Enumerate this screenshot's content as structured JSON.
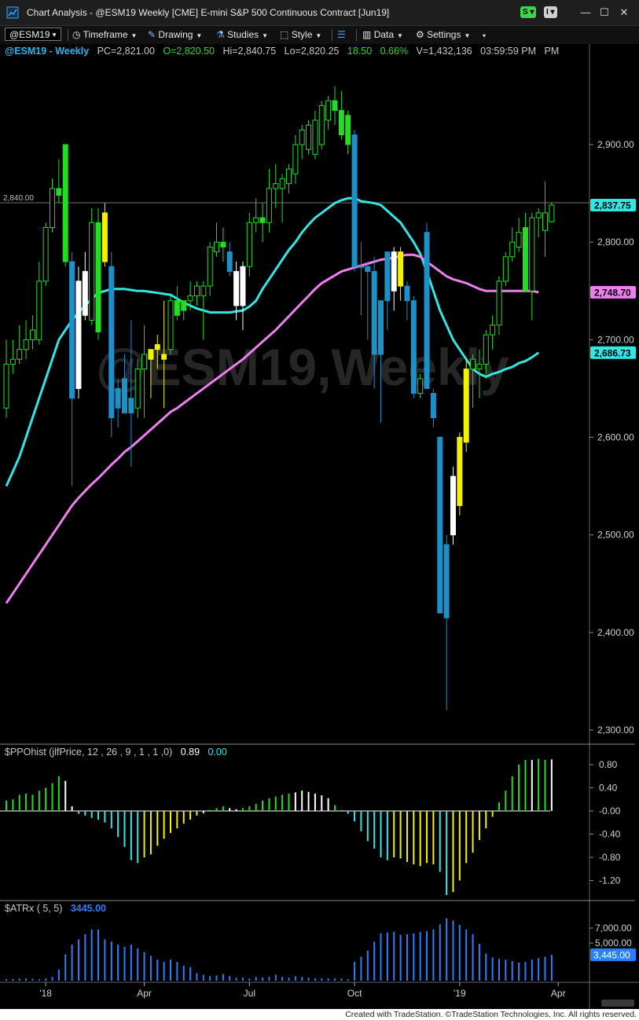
{
  "window": {
    "title": "Chart Analysis - @ESM19 Weekly [CME] E-mini S&P 500 Continuous Contract [Jun19]",
    "pill_s": "S",
    "pill_i": "I"
  },
  "toolbar": {
    "symbol": "@ESM19",
    "timeframe": "Timeframe",
    "drawing": "Drawing",
    "studies": "Studies",
    "style": "Style",
    "data": "Data",
    "settings": "Settings"
  },
  "header": {
    "symbol": "@ESM19 - Weekly",
    "pc": "PC=2,821.00",
    "open": "O=2,820.50",
    "high": "Hi=2,840.75",
    "low": "Lo=2,820.25",
    "change": "18.50",
    "pct": "0.66%",
    "volume": "V=1,432,136",
    "time": "03:59:59 PM",
    "watermark": "@ESM19,Weekly",
    "hline_label": "2,840.00"
  },
  "colors": {
    "bg": "#000000",
    "up": "#22dd22",
    "down": "#1e90c8",
    "yellow": "#f2f200",
    "white": "#ffffff",
    "cyan": "#33e6e6",
    "magenta": "#ee7fee",
    "atr": "#2a7fff"
  },
  "chart_data": [
    {
      "type": "candlestick",
      "title": "@ESM19 - Weekly",
      "ylim": [
        2290,
        2960
      ],
      "y_ticks": [
        "2,900.00",
        "2,800.00",
        "2,700.00",
        "2,600.00",
        "2,500.00",
        "2,400.00",
        "2,300.00"
      ],
      "x_ticks": [
        "'18",
        "Apr",
        "Jul",
        "Oct",
        "'19",
        "Apr"
      ],
      "last_price_labels": [
        "2,837.75",
        "2,748.70",
        "2,686.73"
      ],
      "reference_line": 2840,
      "candles": [
        {
          "o": 2630,
          "h": 2700,
          "l": 2620,
          "c": 2675,
          "col": "up"
        },
        {
          "o": 2675,
          "h": 2700,
          "l": 2665,
          "c": 2680,
          "col": "up"
        },
        {
          "o": 2680,
          "h": 2715,
          "l": 2675,
          "c": 2690,
          "col": "up"
        },
        {
          "o": 2690,
          "h": 2720,
          "l": 2680,
          "c": 2700,
          "col": "up"
        },
        {
          "o": 2700,
          "h": 2725,
          "l": 2690,
          "c": 2710,
          "col": "up"
        },
        {
          "o": 2700,
          "h": 2780,
          "l": 2695,
          "c": 2760,
          "col": "up"
        },
        {
          "o": 2760,
          "h": 2820,
          "l": 2755,
          "c": 2815,
          "col": "up"
        },
        {
          "o": 2815,
          "h": 2865,
          "l": 2810,
          "c": 2855,
          "col": "up"
        },
        {
          "o": 2855,
          "h": 2885,
          "l": 2840,
          "c": 2848,
          "col": "up"
        },
        {
          "o": 2900,
          "h": 2900,
          "l": 2775,
          "c": 2780,
          "col": "up"
        },
        {
          "o": 2780,
          "h": 2790,
          "l": 2550,
          "c": 2640,
          "col": "down"
        },
        {
          "o": 2650,
          "h": 2775,
          "l": 2640,
          "c": 2760,
          "col": "white"
        },
        {
          "o": 2725,
          "h": 2790,
          "l": 2720,
          "c": 2770,
          "col": "white"
        },
        {
          "o": 2720,
          "h": 2835,
          "l": 2715,
          "c": 2820,
          "col": "up"
        },
        {
          "o": 2820,
          "h": 2835,
          "l": 2700,
          "c": 2708,
          "col": "up"
        },
        {
          "o": 2780,
          "h": 2840,
          "l": 2775,
          "c": 2830,
          "col": "yellow"
        },
        {
          "o": 2775,
          "h": 2790,
          "l": 2600,
          "c": 2620,
          "col": "down"
        },
        {
          "o": 2630,
          "h": 2660,
          "l": 2610,
          "c": 2650,
          "col": "down"
        },
        {
          "o": 2660,
          "h": 2685,
          "l": 2625,
          "c": 2625,
          "col": "down"
        },
        {
          "o": 2640,
          "h": 2720,
          "l": 2570,
          "c": 2625,
          "col": "down"
        },
        {
          "o": 2630,
          "h": 2680,
          "l": 2620,
          "c": 2670,
          "col": "up"
        },
        {
          "o": 2670,
          "h": 2715,
          "l": 2620,
          "c": 2685,
          "col": "up"
        },
        {
          "o": 2680,
          "h": 2690,
          "l": 2640,
          "c": 2690,
          "col": "yellow"
        },
        {
          "o": 2690,
          "h": 2705,
          "l": 2670,
          "c": 2695,
          "col": "yellow"
        },
        {
          "o": 2680,
          "h": 2740,
          "l": 2630,
          "c": 2685,
          "col": "yellow"
        },
        {
          "o": 2690,
          "h": 2745,
          "l": 2685,
          "c": 2740,
          "col": "up"
        },
        {
          "o": 2740,
          "h": 2755,
          "l": 2720,
          "c": 2725,
          "col": "up"
        },
        {
          "o": 2740,
          "h": 2740,
          "l": 2720,
          "c": 2730,
          "col": "up"
        },
        {
          "o": 2740,
          "h": 2760,
          "l": 2730,
          "c": 2745,
          "col": "up"
        },
        {
          "o": 2745,
          "h": 2760,
          "l": 2735,
          "c": 2755,
          "col": "up"
        },
        {
          "o": 2745,
          "h": 2760,
          "l": 2700,
          "c": 2755,
          "col": "up"
        },
        {
          "o": 2755,
          "h": 2800,
          "l": 2745,
          "c": 2795,
          "col": "up"
        },
        {
          "o": 2790,
          "h": 2820,
          "l": 2785,
          "c": 2800,
          "col": "up"
        },
        {
          "o": 2800,
          "h": 2815,
          "l": 2780,
          "c": 2795,
          "col": "up"
        },
        {
          "o": 2790,
          "h": 2800,
          "l": 2765,
          "c": 2770,
          "col": "down"
        },
        {
          "o": 2770,
          "h": 2780,
          "l": 2720,
          "c": 2735,
          "col": "white"
        },
        {
          "o": 2735,
          "h": 2780,
          "l": 2710,
          "c": 2775,
          "col": "white"
        },
        {
          "o": 2775,
          "h": 2830,
          "l": 2765,
          "c": 2820,
          "col": "up"
        },
        {
          "o": 2820,
          "h": 2845,
          "l": 2810,
          "c": 2825,
          "col": "up"
        },
        {
          "o": 2825,
          "h": 2840,
          "l": 2800,
          "c": 2820,
          "col": "up"
        },
        {
          "o": 2820,
          "h": 2875,
          "l": 2810,
          "c": 2855,
          "col": "up"
        },
        {
          "o": 2855,
          "h": 2880,
          "l": 2835,
          "c": 2860,
          "col": "up"
        },
        {
          "o": 2855,
          "h": 2870,
          "l": 2820,
          "c": 2865,
          "col": "up"
        },
        {
          "o": 2860,
          "h": 2880,
          "l": 2850,
          "c": 2875,
          "col": "up"
        },
        {
          "o": 2870,
          "h": 2910,
          "l": 2860,
          "c": 2900,
          "col": "up"
        },
        {
          "o": 2900,
          "h": 2920,
          "l": 2885,
          "c": 2915,
          "col": "up"
        },
        {
          "o": 2895,
          "h": 2925,
          "l": 2890,
          "c": 2920,
          "col": "up"
        },
        {
          "o": 2890,
          "h": 2935,
          "l": 2885,
          "c": 2925,
          "col": "up"
        },
        {
          "o": 2900,
          "h": 2945,
          "l": 2895,
          "c": 2940,
          "col": "up"
        },
        {
          "o": 2925,
          "h": 2950,
          "l": 2915,
          "c": 2945,
          "col": "up"
        },
        {
          "o": 2945,
          "h": 2960,
          "l": 2920,
          "c": 2935,
          "col": "up"
        },
        {
          "o": 2935,
          "h": 2955,
          "l": 2905,
          "c": 2910,
          "col": "up"
        },
        {
          "o": 2930,
          "h": 2935,
          "l": 2890,
          "c": 2900,
          "col": "up"
        },
        {
          "o": 2910,
          "h": 2915,
          "l": 2770,
          "c": 2775,
          "col": "down"
        },
        {
          "o": 2775,
          "h": 2800,
          "l": 2725,
          "c": 2775,
          "col": "down"
        },
        {
          "o": 2770,
          "h": 2780,
          "l": 2700,
          "c": 2775,
          "col": "down"
        },
        {
          "o": 2770,
          "h": 2785,
          "l": 2650,
          "c": 2685,
          "col": "down"
        },
        {
          "o": 2685,
          "h": 2740,
          "l": 2615,
          "c": 2740,
          "col": "down"
        },
        {
          "o": 2740,
          "h": 2780,
          "l": 2710,
          "c": 2790,
          "col": "down"
        },
        {
          "o": 2790,
          "h": 2795,
          "l": 2730,
          "c": 2750,
          "col": "white"
        },
        {
          "o": 2790,
          "h": 2795,
          "l": 2740,
          "c": 2755,
          "col": "yellow"
        },
        {
          "o": 2755,
          "h": 2760,
          "l": 2720,
          "c": 2740,
          "col": "down"
        },
        {
          "o": 2740,
          "h": 2745,
          "l": 2640,
          "c": 2645,
          "col": "down"
        },
        {
          "o": 2645,
          "h": 2665,
          "l": 2640,
          "c": 2660,
          "col": "up"
        },
        {
          "o": 2810,
          "h": 2820,
          "l": 2650,
          "c": 2650,
          "col": "down"
        },
        {
          "o": 2645,
          "h": 2650,
          "l": 2610,
          "c": 2620,
          "col": "down"
        },
        {
          "o": 2600,
          "h": 2600,
          "l": 2420,
          "c": 2420,
          "col": "down"
        },
        {
          "o": 2415,
          "h": 2500,
          "l": 2320,
          "c": 2490,
          "col": "down"
        },
        {
          "o": 2500,
          "h": 2570,
          "l": 2490,
          "c": 2560,
          "col": "white"
        },
        {
          "o": 2530,
          "h": 2605,
          "l": 2520,
          "c": 2600,
          "col": "yellow"
        },
        {
          "o": 2595,
          "h": 2680,
          "l": 2585,
          "c": 2670,
          "col": "yellow"
        },
        {
          "o": 2670,
          "h": 2685,
          "l": 2630,
          "c": 2680,
          "col": "up"
        },
        {
          "o": 2670,
          "h": 2690,
          "l": 2640,
          "c": 2675,
          "col": "up"
        },
        {
          "o": 2675,
          "h": 2710,
          "l": 2660,
          "c": 2705,
          "col": "up"
        },
        {
          "o": 2705,
          "h": 2725,
          "l": 2690,
          "c": 2715,
          "col": "up"
        },
        {
          "o": 2715,
          "h": 2765,
          "l": 2705,
          "c": 2760,
          "col": "up"
        },
        {
          "o": 2760,
          "h": 2790,
          "l": 2755,
          "c": 2785,
          "col": "up"
        },
        {
          "o": 2785,
          "h": 2815,
          "l": 2780,
          "c": 2800,
          "col": "up"
        },
        {
          "o": 2795,
          "h": 2825,
          "l": 2790,
          "c": 2810,
          "col": "up"
        },
        {
          "o": 2815,
          "h": 2830,
          "l": 2760,
          "c": 2750,
          "col": "up"
        },
        {
          "o": 2750,
          "h": 2830,
          "l": 2720,
          "c": 2825,
          "col": "up"
        },
        {
          "o": 2825,
          "h": 2835,
          "l": 2805,
          "c": 2830,
          "col": "up"
        },
        {
          "o": 2812,
          "h": 2862,
          "l": 2785,
          "c": 2830,
          "col": "up"
        },
        {
          "o": 2821,
          "h": 2841,
          "l": 2820,
          "c": 2838,
          "col": "up"
        }
      ],
      "series": [
        {
          "name": "short average",
          "color": "cyan",
          "values": [
            2550,
            2565,
            2580,
            2600,
            2620,
            2640,
            2660,
            2680,
            2700,
            2710,
            2720,
            2728,
            2735,
            2742,
            2748,
            2750,
            2752,
            2752,
            2752,
            2751,
            2750,
            2750,
            2749,
            2748,
            2747,
            2746,
            2742,
            2738,
            2735,
            2732,
            2730,
            2728,
            2728,
            2728,
            2728,
            2729,
            2730,
            2734,
            2740,
            2752,
            2762,
            2772,
            2782,
            2792,
            2800,
            2810,
            2818,
            2825,
            2830,
            2835,
            2840,
            2843,
            2845,
            2845,
            2842,
            2841,
            2840,
            2838,
            2832,
            2826,
            2820,
            2810,
            2800,
            2788,
            2770,
            2750,
            2730,
            2715,
            2700,
            2690,
            2680,
            2670,
            2665,
            2662,
            2665,
            2667,
            2670,
            2672,
            2676,
            2678,
            2682,
            2686.73
          ]
        },
        {
          "name": "long average",
          "color": "magenta",
          "values": [
            2430,
            2440,
            2450,
            2460,
            2470,
            2480,
            2490,
            2500,
            2510,
            2520,
            2530,
            2538,
            2545,
            2552,
            2558,
            2565,
            2572,
            2578,
            2585,
            2590,
            2596,
            2602,
            2608,
            2614,
            2620,
            2626,
            2630,
            2635,
            2640,
            2645,
            2650,
            2655,
            2660,
            2665,
            2670,
            2675,
            2680,
            2686,
            2692,
            2698,
            2704,
            2710,
            2717,
            2724,
            2731,
            2738,
            2745,
            2752,
            2758,
            2762,
            2766,
            2770,
            2772,
            2774,
            2776,
            2778,
            2780,
            2782,
            2783,
            2784,
            2786,
            2787,
            2787,
            2785,
            2780,
            2775,
            2770,
            2765,
            2762,
            2760,
            2758,
            2755,
            2752,
            2750,
            2750,
            2750,
            2750,
            2750,
            2750,
            2750,
            2750,
            2748.7
          ]
        }
      ]
    },
    {
      "type": "bar",
      "title": "$PPOhist (jlfPrice, 12 , 26 , 9 , 1 , 1 ,0)",
      "readout_1": "0.89",
      "readout_2": "0.00",
      "ylim": [
        -1.5,
        1.0
      ],
      "y_ticks": [
        "0.80",
        "0.40",
        "-0.00",
        "-0.40",
        "-0.80",
        "-1.20"
      ],
      "values": [
        0.18,
        0.2,
        0.28,
        0.3,
        0.28,
        0.35,
        0.4,
        0.48,
        0.6,
        0.52,
        0.08,
        -0.05,
        -0.08,
        -0.12,
        -0.15,
        -0.2,
        -0.3,
        -0.45,
        -0.62,
        -0.85,
        -0.9,
        -0.8,
        -0.75,
        -0.6,
        -0.48,
        -0.38,
        -0.3,
        -0.22,
        -0.15,
        -0.08,
        -0.04,
        0.02,
        0.05,
        0.08,
        0.05,
        0.03,
        0.05,
        0.08,
        0.12,
        0.18,
        0.22,
        0.25,
        0.28,
        0.3,
        0.32,
        0.35,
        0.33,
        0.3,
        0.27,
        0.22,
        0.1,
        0.02,
        -0.05,
        -0.18,
        -0.35,
        -0.52,
        -0.65,
        -0.8,
        -0.85,
        -0.8,
        -0.82,
        -0.88,
        -0.92,
        -0.95,
        -0.9,
        -0.92,
        -1.05,
        -1.45,
        -1.4,
        -1.2,
        -0.9,
        -0.72,
        -0.5,
        -0.3,
        -0.1,
        0.15,
        0.35,
        0.6,
        0.8,
        0.88,
        0.88,
        0.9,
        0.88,
        0.89
      ],
      "colors": [
        "up",
        "up",
        "up",
        "up",
        "up",
        "up",
        "up",
        "up",
        "up",
        "white",
        "white",
        "cyan",
        "cyan",
        "cyan",
        "cyan",
        "cyan",
        "cyan",
        "cyan",
        "cyan",
        "cyan",
        "cyan",
        "yellow",
        "yellow",
        "yellow",
        "yellow",
        "yellow",
        "yellow",
        "yellow",
        "yellow",
        "yellow",
        "white",
        "up",
        "up",
        "up",
        "white",
        "white",
        "up",
        "up",
        "up",
        "up",
        "up",
        "up",
        "up",
        "up",
        "white",
        "white",
        "white",
        "white",
        "white",
        "white",
        "up",
        "up",
        "cyan",
        "cyan",
        "cyan",
        "cyan",
        "cyan",
        "cyan",
        "cyan",
        "yellow",
        "yellow",
        "yellow",
        "yellow",
        "yellow",
        "yellow",
        "yellow",
        "cyan",
        "cyan",
        "yellow",
        "yellow",
        "yellow",
        "yellow",
        "yellow",
        "yellow",
        "yellow",
        "up",
        "up",
        "up",
        "up",
        "up",
        "white",
        "up",
        "up",
        "white"
      ]
    },
    {
      "type": "bar",
      "title": "$ATRx ( 5, 5)",
      "readout": "3445.00",
      "ylim": [
        0,
        8000
      ],
      "y_ticks": [
        "7,000.00",
        "5,000.00"
      ],
      "last_value_label": "3,445.00",
      "values": [
        200,
        250,
        300,
        300,
        250,
        200,
        300,
        500,
        1500,
        3500,
        4800,
        5500,
        6200,
        6800,
        6800,
        5500,
        5200,
        4800,
        4500,
        4800,
        4300,
        3800,
        3300,
        2800,
        2500,
        2800,
        2500,
        2000,
        1800,
        1000,
        800,
        600,
        700,
        900,
        600,
        400,
        400,
        300,
        500,
        400,
        500,
        800,
        500,
        400,
        600,
        500,
        400,
        300,
        300,
        300,
        300,
        300,
        200,
        2500,
        3200,
        4000,
        5200,
        6300,
        6400,
        6500,
        6100,
        6200,
        6300,
        6500,
        6600,
        6800,
        7500,
        8300,
        8000,
        7400,
        6800,
        6200,
        4900,
        3600,
        3100,
        2900,
        2800,
        2600,
        2400,
        2500,
        2800,
        3000,
        3200,
        3445
      ]
    }
  ],
  "footer": "Created with TradeStation. ©TradeStation Technologies, Inc. All rights reserved."
}
